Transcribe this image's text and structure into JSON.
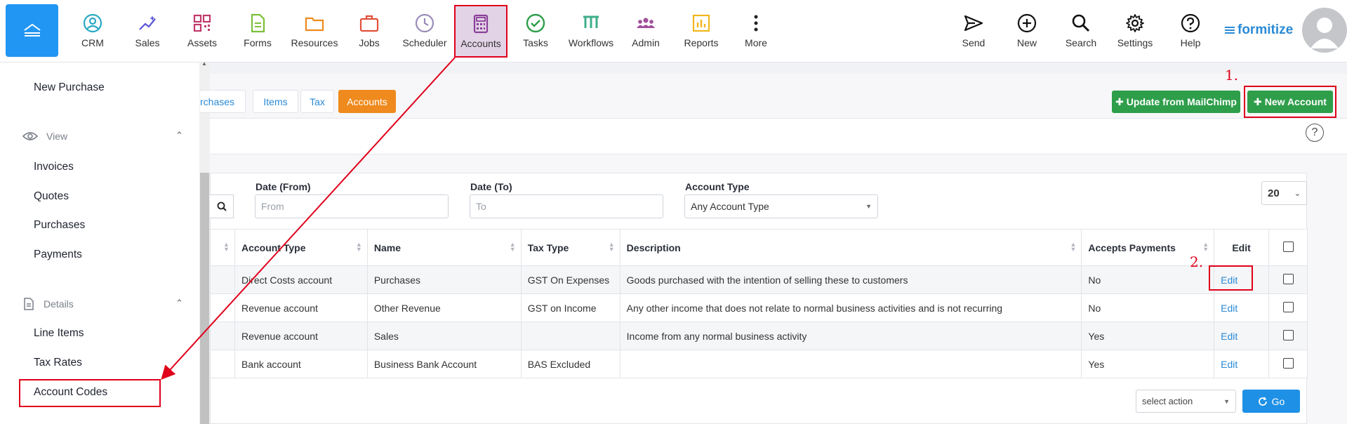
{
  "nav": {
    "items": [
      {
        "label": "CRM",
        "icon": "user-circle-icon",
        "color": "#2aa8c4"
      },
      {
        "label": "Sales",
        "icon": "sparkle-chart-icon",
        "color": "#5b55d6"
      },
      {
        "label": "Assets",
        "icon": "qr-code-icon",
        "color": "#c0396b"
      },
      {
        "label": "Forms",
        "icon": "document-icon",
        "color": "#7cbf3a"
      },
      {
        "label": "Resources",
        "icon": "folder-icon",
        "color": "#ef8a1e"
      },
      {
        "label": "Jobs",
        "icon": "briefcase-icon",
        "color": "#e0503a"
      },
      {
        "label": "Scheduler",
        "icon": "clock-icon",
        "color": "#9a8cb8"
      },
      {
        "label": "Accounts",
        "icon": "calculator-icon",
        "color": "#8a3f9a"
      },
      {
        "label": "Tasks",
        "icon": "check-circle-icon",
        "color": "#2e9e4a"
      },
      {
        "label": "Workflows",
        "icon": "workflow-icon",
        "color": "#3fae8a"
      },
      {
        "label": "Admin",
        "icon": "people-icon",
        "color": "#a0509a"
      },
      {
        "label": "Reports",
        "icon": "bar-chart-icon",
        "color": "#f0b81e"
      },
      {
        "label": "More",
        "icon": "more-vertical-icon",
        "color": "#222222"
      }
    ],
    "right_items": [
      {
        "label": "Send",
        "icon": "send-icon"
      },
      {
        "label": "New",
        "icon": "plus-circle-icon"
      },
      {
        "label": "Search",
        "icon": "search-icon"
      },
      {
        "label": "Settings",
        "icon": "gear-icon"
      },
      {
        "label": "Help",
        "icon": "help-circle-icon"
      }
    ],
    "brand": "formitize"
  },
  "sidebar": {
    "new_purchase": "New Purchase",
    "view_section": "View",
    "view_items": [
      "Invoices",
      "Quotes",
      "Purchases",
      "Payments"
    ],
    "details_section": "Details",
    "details_items": [
      "Line Items",
      "Tax Rates",
      "Account Codes"
    ]
  },
  "tabs": [
    "rchases",
    "Items",
    "Tax",
    "Accounts"
  ],
  "buttons": {
    "update": "Update from MailChimp",
    "new_account": "New Account",
    "go": "Go"
  },
  "filters": {
    "date_from_label": "Date (From)",
    "date_from_placeholder": "From",
    "date_to_label": "Date (To)",
    "date_to_placeholder": "To",
    "account_type_label": "Account Type",
    "account_type_value": "Any Account Type",
    "page_size": "20",
    "bulk_action": "select action"
  },
  "table": {
    "headers": [
      "Account Type",
      "Name",
      "Tax Type",
      "Description",
      "Accepts Payments",
      "Edit"
    ],
    "rows": [
      {
        "type": "Direct Costs account",
        "name": "Purchases",
        "tax": "GST On Expenses",
        "desc": "Goods purchased with the intention of selling these to customers",
        "pay": "No",
        "edit": "Edit"
      },
      {
        "type": "Revenue account",
        "name": "Other Revenue",
        "tax": "GST on Income",
        "desc": "Any other income that does not relate to normal business activities and is not recurring",
        "pay": "No",
        "edit": "Edit"
      },
      {
        "type": "Revenue account",
        "name": "Sales",
        "tax": "",
        "desc": "Income from any normal business activity",
        "pay": "Yes",
        "edit": "Edit"
      },
      {
        "type": "Bank account",
        "name": "Business Bank Account",
        "tax": "BAS Excluded",
        "desc": "",
        "pay": "Yes",
        "edit": "Edit"
      }
    ]
  },
  "annotations": {
    "step1": "1.",
    "step2": "2."
  },
  "colors": {
    "accent_blue": "#2196f3",
    "green": "#2e9e4a",
    "orange": "#ef8a1e",
    "annotation_red": "#e0001b"
  }
}
